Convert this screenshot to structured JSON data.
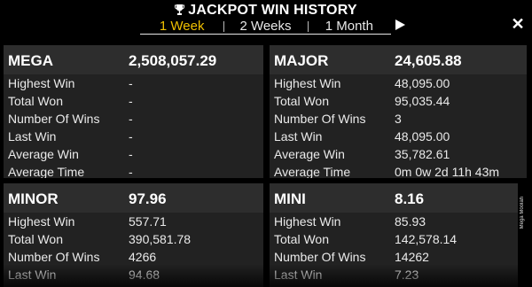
{
  "header": {
    "title": "JACKPOT WIN HISTORY",
    "tabs": [
      "1 Week",
      "2 Weeks",
      "1 Month"
    ],
    "active_tab": "1 Week",
    "close_symbol": "✕"
  },
  "side_label": "Mega Moolah",
  "panels": [
    {
      "name": "MEGA",
      "amount": "2,508,057.29",
      "rows": [
        {
          "label": "Highest Win",
          "value": "-"
        },
        {
          "label": "Total Won",
          "value": "-"
        },
        {
          "label": "Number Of Wins",
          "value": "-"
        },
        {
          "label": "Last Win",
          "value": "-"
        },
        {
          "label": "Average Win",
          "value": "-"
        },
        {
          "label": "Average Time",
          "value": "-"
        }
      ]
    },
    {
      "name": "MAJOR",
      "amount": "24,605.88",
      "rows": [
        {
          "label": "Highest Win",
          "value": "48,095.00"
        },
        {
          "label": "Total Won",
          "value": "95,035.44"
        },
        {
          "label": "Number Of Wins",
          "value": "3"
        },
        {
          "label": "Last Win",
          "value": "48,095.00"
        },
        {
          "label": "Average Win",
          "value": "35,782.61"
        },
        {
          "label": "Average Time",
          "value": "0m 0w 2d 11h 43m"
        }
      ]
    },
    {
      "name": "MINOR",
      "amount": "97.96",
      "rows": [
        {
          "label": "Highest Win",
          "value": "557.71"
        },
        {
          "label": "Total Won",
          "value": "390,581.78"
        },
        {
          "label": "Number Of Wins",
          "value": "4266"
        },
        {
          "label": "Last Win",
          "value": "94.68"
        }
      ]
    },
    {
      "name": "MINI",
      "amount": "8.16",
      "rows": [
        {
          "label": "Highest Win",
          "value": "85.93"
        },
        {
          "label": "Total Won",
          "value": "142,578.14"
        },
        {
          "label": "Number Of Wins",
          "value": "14262"
        },
        {
          "label": "Last Win",
          "value": "7.23"
        }
      ]
    }
  ],
  "colors": {
    "background": "#000000",
    "panel": "#222222",
    "panel_header": "#2d2d2d",
    "active_tab": "#f0c000"
  }
}
